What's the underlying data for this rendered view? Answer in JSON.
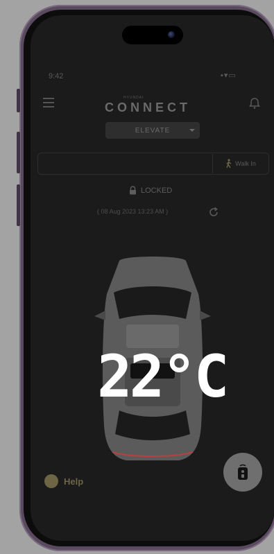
{
  "status_bar": {
    "time": "9:42",
    "signal_icons": "▪▾▭"
  },
  "header": {
    "brand_small": "HYUNDAI",
    "brand": "CONNECT",
    "variant": "ELEVATE"
  },
  "walk_in": {
    "label": "Walk In"
  },
  "lock_status": {
    "label": "LOCKED"
  },
  "last_updated": {
    "text": "( 08 Aug 2023 13:23 AM )"
  },
  "climate": {
    "temperature": "22°C"
  },
  "help": {
    "label": "Help"
  },
  "colors": {
    "screen_bg": "#1b1b1b",
    "help_accent": "#6d6544",
    "temperature_text": "#ffffff",
    "remote_button_bg": "#6f6f6f"
  }
}
